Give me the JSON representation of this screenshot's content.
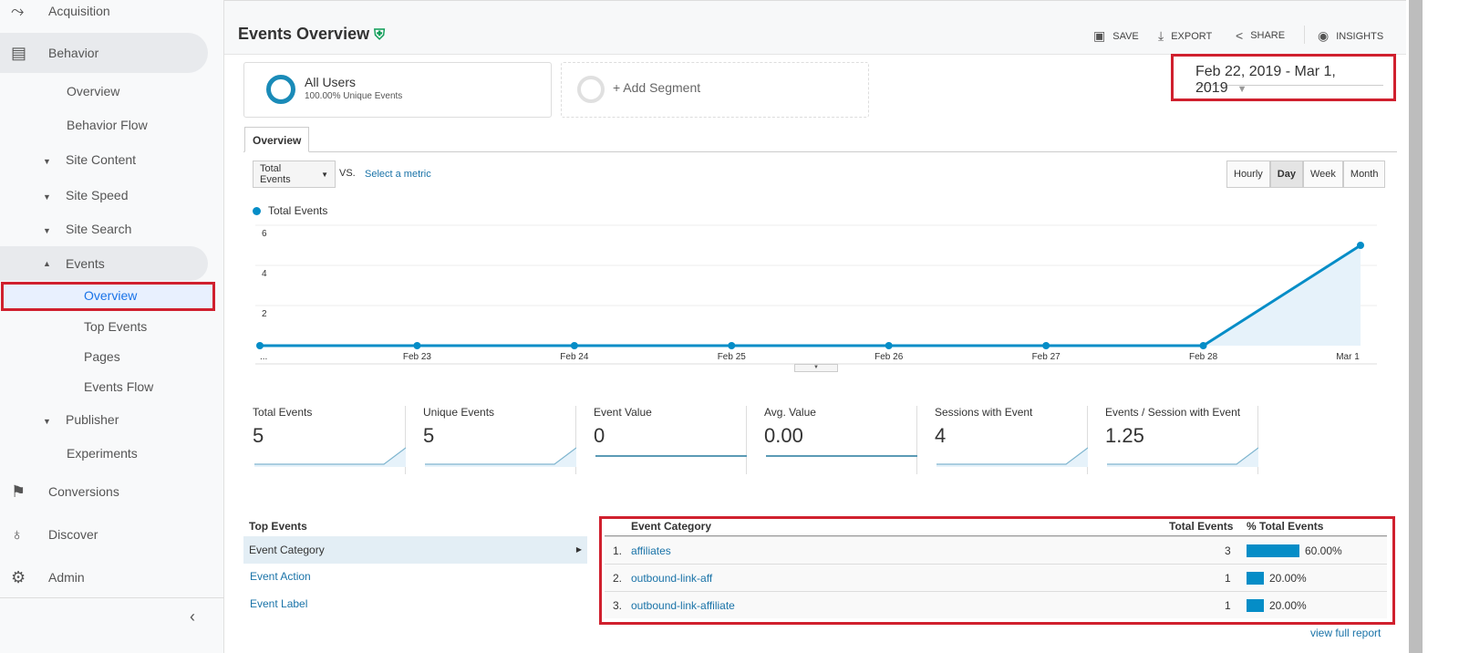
{
  "sidebar": {
    "top_items": [
      {
        "label": "Acquisition",
        "icon": "acquisition-icon"
      },
      {
        "label": "Behavior",
        "icon": "behavior-icon"
      },
      {
        "label": "Conversions",
        "icon": "flag-icon"
      },
      {
        "label": "Discover",
        "icon": "lightbulb-icon"
      },
      {
        "label": "Admin",
        "icon": "gear-icon"
      }
    ],
    "behavior_items": [
      "Overview",
      "Behavior Flow",
      "Site Content",
      "Site Speed",
      "Site Search",
      "Events",
      "Publisher",
      "Experiments"
    ],
    "events_items": [
      "Overview",
      "Top Events",
      "Pages",
      "Events Flow"
    ],
    "collapse_icon": "chevron-left-icon"
  },
  "header": {
    "title": "Events Overview",
    "actions": [
      "SAVE",
      "EXPORT",
      "SHARE",
      "INSIGHTS"
    ]
  },
  "segments": {
    "name": "All Users",
    "sub": "100.00% Unique Events",
    "add": "+ Add Segment"
  },
  "date_range": "Feb 22, 2019 - Mar 1, 2019",
  "tab": "Overview",
  "metric_select": "Total Events",
  "vs": "VS.",
  "select_metric": "Select a metric",
  "granularity": [
    "Hourly",
    "Day",
    "Week",
    "Month"
  ],
  "granularity_selected": "Day",
  "chart_data": {
    "type": "area",
    "legend": "Total Events",
    "color": "#058dc7",
    "x": [
      "...",
      "Feb 23",
      "Feb 24",
      "Feb 25",
      "Feb 26",
      "Feb 27",
      "Feb 28",
      "Mar 1"
    ],
    "values": [
      0,
      0,
      0,
      0,
      0,
      0,
      0,
      5
    ],
    "yticks": [
      "2",
      "4",
      "6"
    ],
    "ylim": [
      0,
      6
    ],
    "grid": true
  },
  "scorecards": [
    {
      "label": "Total Events",
      "value": "5",
      "trend": "up"
    },
    {
      "label": "Unique Events",
      "value": "5",
      "trend": "up"
    },
    {
      "label": "Event Value",
      "value": "0",
      "trend": "flat"
    },
    {
      "label": "Avg. Value",
      "value": "0.00",
      "trend": "flat"
    },
    {
      "label": "Sessions with Event",
      "value": "4",
      "trend": "up"
    },
    {
      "label": "Events / Session with Event",
      "value": "1.25",
      "trend": "up"
    }
  ],
  "top_events": {
    "title": "Top Events",
    "items": [
      "Event Category",
      "Event Action",
      "Event Label"
    ]
  },
  "table": {
    "headers": [
      "Event Category",
      "Total Events",
      "% Total Events"
    ],
    "rows": [
      {
        "rank": "1.",
        "name": "affiliates",
        "total": "3",
        "pct": "60.00%",
        "frac": 0.6
      },
      {
        "rank": "2.",
        "name": "outbound-link-aff",
        "total": "1",
        "pct": "20.00%",
        "frac": 0.2
      },
      {
        "rank": "3.",
        "name": "outbound-link-affiliate",
        "total": "1",
        "pct": "20.00%",
        "frac": 0.2
      }
    ],
    "view_full": "view full report"
  }
}
